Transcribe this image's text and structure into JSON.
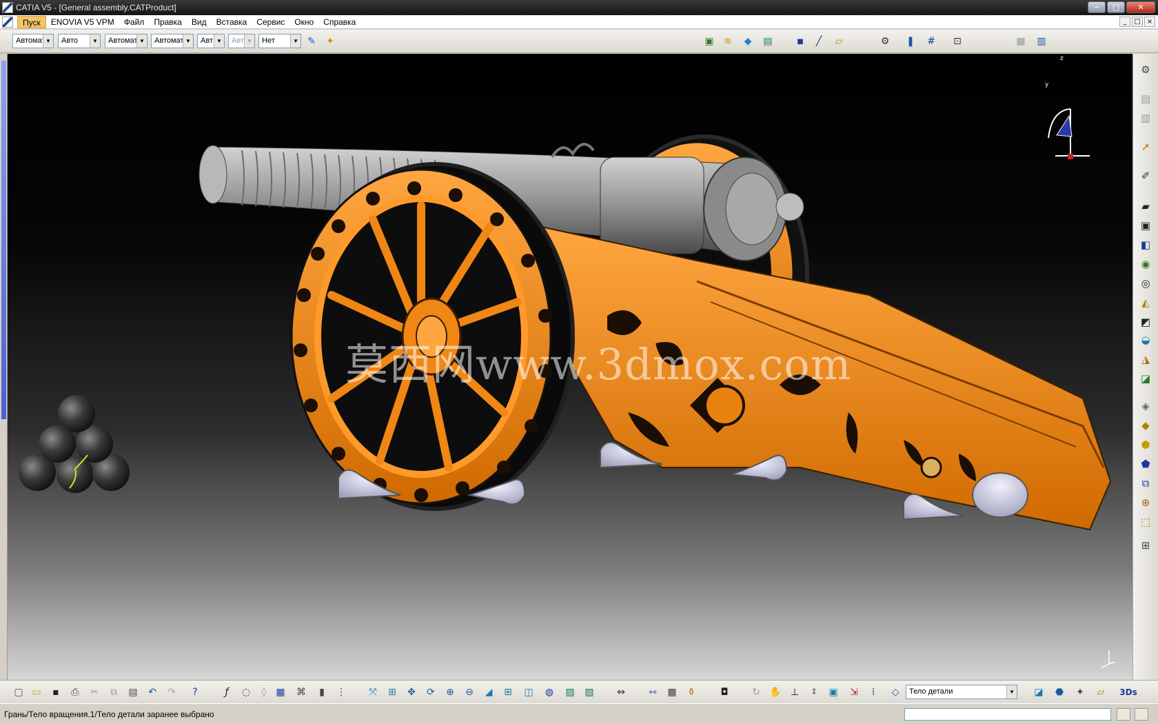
{
  "window": {
    "title": "CATIA V5 - [General assembly.CATProduct]",
    "controls": [
      "−",
      "□",
      "✕"
    ]
  },
  "menubar": {
    "items": [
      "Пуск",
      "ENOVIA V5 VPM",
      "Файл",
      "Правка",
      "Вид",
      "Вставка",
      "Сервис",
      "Окно",
      "Справка"
    ],
    "document_controls": [
      "_",
      "□",
      "×"
    ]
  },
  "toolbar_top": {
    "combos": [
      {
        "value": "Автомат",
        "enabled": true
      },
      {
        "value": "Авто",
        "enabled": true
      },
      {
        "value": "Автомат",
        "enabled": true
      },
      {
        "value": "Автомат",
        "enabled": true
      },
      {
        "value": "Авт",
        "enabled": true
      },
      {
        "value": "Авт",
        "enabled": false
      },
      {
        "value": "Нет",
        "enabled": true
      }
    ],
    "icons": [
      "painter-icon",
      "graphic-properties-icon",
      "part-body-icon",
      "surface-icon",
      "eraser-icon",
      "catalog-icon",
      "point-icon",
      "line-icon",
      "plane-icon",
      "measure-icon",
      "sketch-icon",
      "grid-icon",
      "snap-icon",
      "layout-icon",
      "window-icon"
    ]
  },
  "viewport": {
    "watermark": "莫西网www.3dmox.com",
    "compass_axes": [
      "z",
      "y",
      "x"
    ],
    "colors": {
      "carriage": "#e8820e",
      "barrel": "#9a9a9a",
      "background_top": "#000000",
      "background_bottom": "#d6d6d6"
    }
  },
  "toolbar_right": {
    "icons": [
      "settings-icon",
      "copy-icon",
      "paste-icon",
      "select-icon",
      "sketcher-icon",
      "pad-icon",
      "pocket-icon",
      "shaft-icon",
      "groove-icon",
      "hole-icon",
      "rib-icon",
      "slot-icon",
      "fillet-icon",
      "chamfer-icon",
      "draft-icon",
      "shell-icon",
      "thickness-icon",
      "thread-icon",
      "remove-face-icon",
      "translate-icon",
      "mirror-icon",
      "boolean-icon",
      "axis-system-icon",
      "publication-icon"
    ]
  },
  "toolbar_bottom": {
    "icons": [
      "new-icon",
      "open-icon",
      "save-icon",
      "print-icon",
      "cut-icon",
      "copy-icon",
      "paste-icon",
      "undo-icon",
      "redo-icon",
      "whats-this-icon",
      "formula-icon",
      "comment-icon",
      "update-icon",
      "table-icon",
      "tree-icon",
      "lock-icon",
      "visualization-icon",
      "fit-all-icon",
      "pan-icon",
      "rotate-icon",
      "zoom-in-icon",
      "zoom-out-icon",
      "normal-view-icon",
      "multi-view-icon",
      "iso-view-icon",
      "shading-icon",
      "hide-show-icon",
      "swap-icon",
      "capture-icon",
      "measure-between-icon",
      "measure-item-icon",
      "inertia-icon",
      "camera-icon",
      "refresh-icon",
      "hand-icon",
      "axis-icon",
      "coordinates-icon",
      "layer-icon",
      "filter-icon",
      "select-body-icon",
      "edit-icon",
      "knowledge-icon",
      "check-icon",
      "catalog-icon"
    ],
    "select_body": {
      "value": "Тело детали"
    }
  },
  "statusbar": {
    "message": "Грань/Тело вращения.1/Тело детали заранее выбрано"
  }
}
